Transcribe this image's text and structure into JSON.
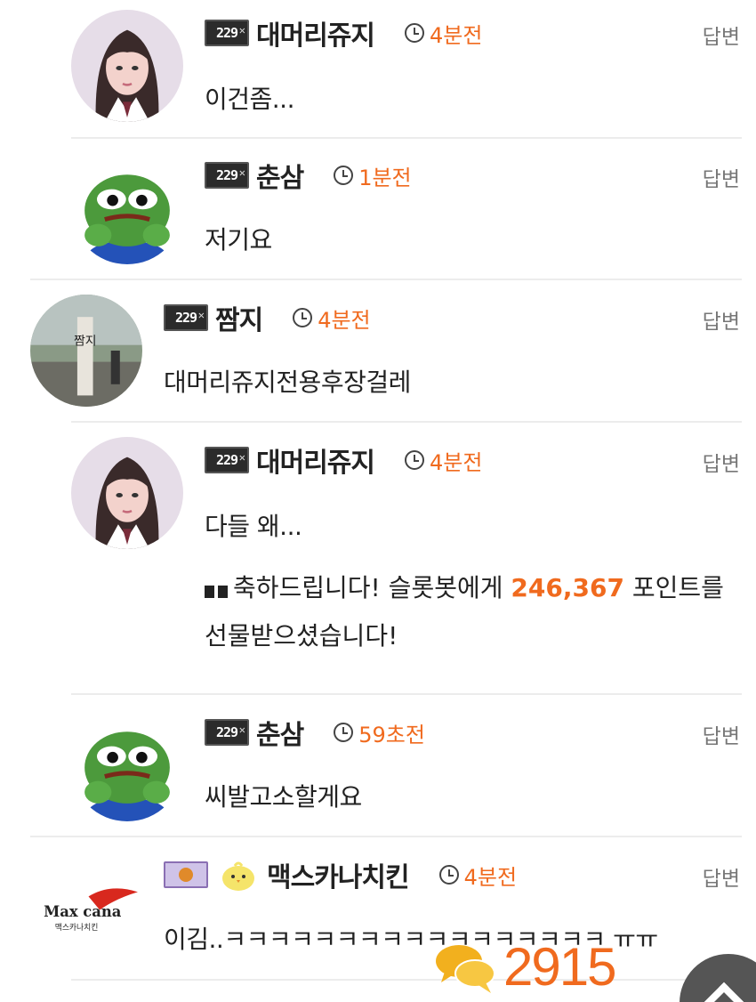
{
  "comments": [
    {
      "nick": "대머리쥬지",
      "time": "4분전",
      "reply": "답변",
      "text": "이건좀..."
    },
    {
      "nick": "춘삼",
      "time": "1분전",
      "reply": "답변",
      "text": "저기요"
    },
    {
      "nick": "짬지",
      "time": "4분전",
      "reply": "답변",
      "text": "대머리쥬지전용후장걸레"
    },
    {
      "nick": "대머리쥬지",
      "time": "4분전",
      "reply": "답변",
      "text": "다들 왜..."
    },
    {
      "nick": "춘삼",
      "time": "59초전",
      "reply": "답변",
      "text": "씨발고소할게요"
    },
    {
      "nick": "맥스카나치킨",
      "time": "4분전",
      "reply": "답변",
      "text": "이김..ㅋㅋㅋㅋㅋㅋㅋㅋㅋㅋㅋㅋㅋㅋㅋㅋㅋ ㅠㅠ"
    }
  ],
  "gift": {
    "prefix": "축하드립니다! 슬롯봇에게 ",
    "amount": "246,367",
    "suffix": " 포인트를 선물받으셨습니다!"
  },
  "level_badge": "229",
  "avatar_logo": {
    "line1": "Max cana",
    "line2": "맥스카나치킨"
  },
  "avatar_sign": "짬지",
  "comment_count": "2915",
  "accent_color": "#f06a1e"
}
